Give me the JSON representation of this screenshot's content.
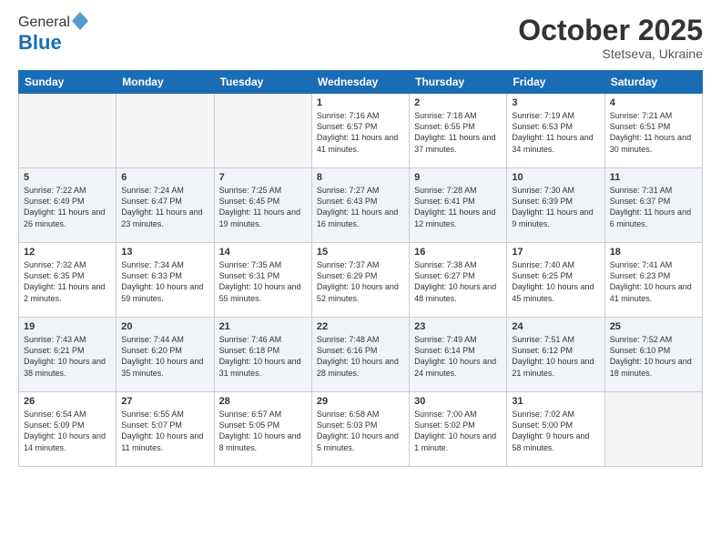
{
  "header": {
    "logo_general": "General",
    "logo_blue": "Blue",
    "month": "October 2025",
    "location": "Stetseva, Ukraine"
  },
  "days_of_week": [
    "Sunday",
    "Monday",
    "Tuesday",
    "Wednesday",
    "Thursday",
    "Friday",
    "Saturday"
  ],
  "weeks": [
    [
      {
        "day": "",
        "info": ""
      },
      {
        "day": "",
        "info": ""
      },
      {
        "day": "",
        "info": ""
      },
      {
        "day": "1",
        "info": "Sunrise: 7:16 AM\nSunset: 6:57 PM\nDaylight: 11 hours and 41 minutes."
      },
      {
        "day": "2",
        "info": "Sunrise: 7:18 AM\nSunset: 6:55 PM\nDaylight: 11 hours and 37 minutes."
      },
      {
        "day": "3",
        "info": "Sunrise: 7:19 AM\nSunset: 6:53 PM\nDaylight: 11 hours and 34 minutes."
      },
      {
        "day": "4",
        "info": "Sunrise: 7:21 AM\nSunset: 6:51 PM\nDaylight: 11 hours and 30 minutes."
      }
    ],
    [
      {
        "day": "5",
        "info": "Sunrise: 7:22 AM\nSunset: 6:49 PM\nDaylight: 11 hours and 26 minutes."
      },
      {
        "day": "6",
        "info": "Sunrise: 7:24 AM\nSunset: 6:47 PM\nDaylight: 11 hours and 23 minutes."
      },
      {
        "day": "7",
        "info": "Sunrise: 7:25 AM\nSunset: 6:45 PM\nDaylight: 11 hours and 19 minutes."
      },
      {
        "day": "8",
        "info": "Sunrise: 7:27 AM\nSunset: 6:43 PM\nDaylight: 11 hours and 16 minutes."
      },
      {
        "day": "9",
        "info": "Sunrise: 7:28 AM\nSunset: 6:41 PM\nDaylight: 11 hours and 12 minutes."
      },
      {
        "day": "10",
        "info": "Sunrise: 7:30 AM\nSunset: 6:39 PM\nDaylight: 11 hours and 9 minutes."
      },
      {
        "day": "11",
        "info": "Sunrise: 7:31 AM\nSunset: 6:37 PM\nDaylight: 11 hours and 6 minutes."
      }
    ],
    [
      {
        "day": "12",
        "info": "Sunrise: 7:32 AM\nSunset: 6:35 PM\nDaylight: 11 hours and 2 minutes."
      },
      {
        "day": "13",
        "info": "Sunrise: 7:34 AM\nSunset: 6:33 PM\nDaylight: 10 hours and 59 minutes."
      },
      {
        "day": "14",
        "info": "Sunrise: 7:35 AM\nSunset: 6:31 PM\nDaylight: 10 hours and 55 minutes."
      },
      {
        "day": "15",
        "info": "Sunrise: 7:37 AM\nSunset: 6:29 PM\nDaylight: 10 hours and 52 minutes."
      },
      {
        "day": "16",
        "info": "Sunrise: 7:38 AM\nSunset: 6:27 PM\nDaylight: 10 hours and 48 minutes."
      },
      {
        "day": "17",
        "info": "Sunrise: 7:40 AM\nSunset: 6:25 PM\nDaylight: 10 hours and 45 minutes."
      },
      {
        "day": "18",
        "info": "Sunrise: 7:41 AM\nSunset: 6:23 PM\nDaylight: 10 hours and 41 minutes."
      }
    ],
    [
      {
        "day": "19",
        "info": "Sunrise: 7:43 AM\nSunset: 6:21 PM\nDaylight: 10 hours and 38 minutes."
      },
      {
        "day": "20",
        "info": "Sunrise: 7:44 AM\nSunset: 6:20 PM\nDaylight: 10 hours and 35 minutes."
      },
      {
        "day": "21",
        "info": "Sunrise: 7:46 AM\nSunset: 6:18 PM\nDaylight: 10 hours and 31 minutes."
      },
      {
        "day": "22",
        "info": "Sunrise: 7:48 AM\nSunset: 6:16 PM\nDaylight: 10 hours and 28 minutes."
      },
      {
        "day": "23",
        "info": "Sunrise: 7:49 AM\nSunset: 6:14 PM\nDaylight: 10 hours and 24 minutes."
      },
      {
        "day": "24",
        "info": "Sunrise: 7:51 AM\nSunset: 6:12 PM\nDaylight: 10 hours and 21 minutes."
      },
      {
        "day": "25",
        "info": "Sunrise: 7:52 AM\nSunset: 6:10 PM\nDaylight: 10 hours and 18 minutes."
      }
    ],
    [
      {
        "day": "26",
        "info": "Sunrise: 6:54 AM\nSunset: 5:09 PM\nDaylight: 10 hours and 14 minutes."
      },
      {
        "day": "27",
        "info": "Sunrise: 6:55 AM\nSunset: 5:07 PM\nDaylight: 10 hours and 11 minutes."
      },
      {
        "day": "28",
        "info": "Sunrise: 6:57 AM\nSunset: 5:05 PM\nDaylight: 10 hours and 8 minutes."
      },
      {
        "day": "29",
        "info": "Sunrise: 6:58 AM\nSunset: 5:03 PM\nDaylight: 10 hours and 5 minutes."
      },
      {
        "day": "30",
        "info": "Sunrise: 7:00 AM\nSunset: 5:02 PM\nDaylight: 10 hours and 1 minute."
      },
      {
        "day": "31",
        "info": "Sunrise: 7:02 AM\nSunset: 5:00 PM\nDaylight: 9 hours and 58 minutes."
      },
      {
        "day": "",
        "info": ""
      }
    ]
  ]
}
